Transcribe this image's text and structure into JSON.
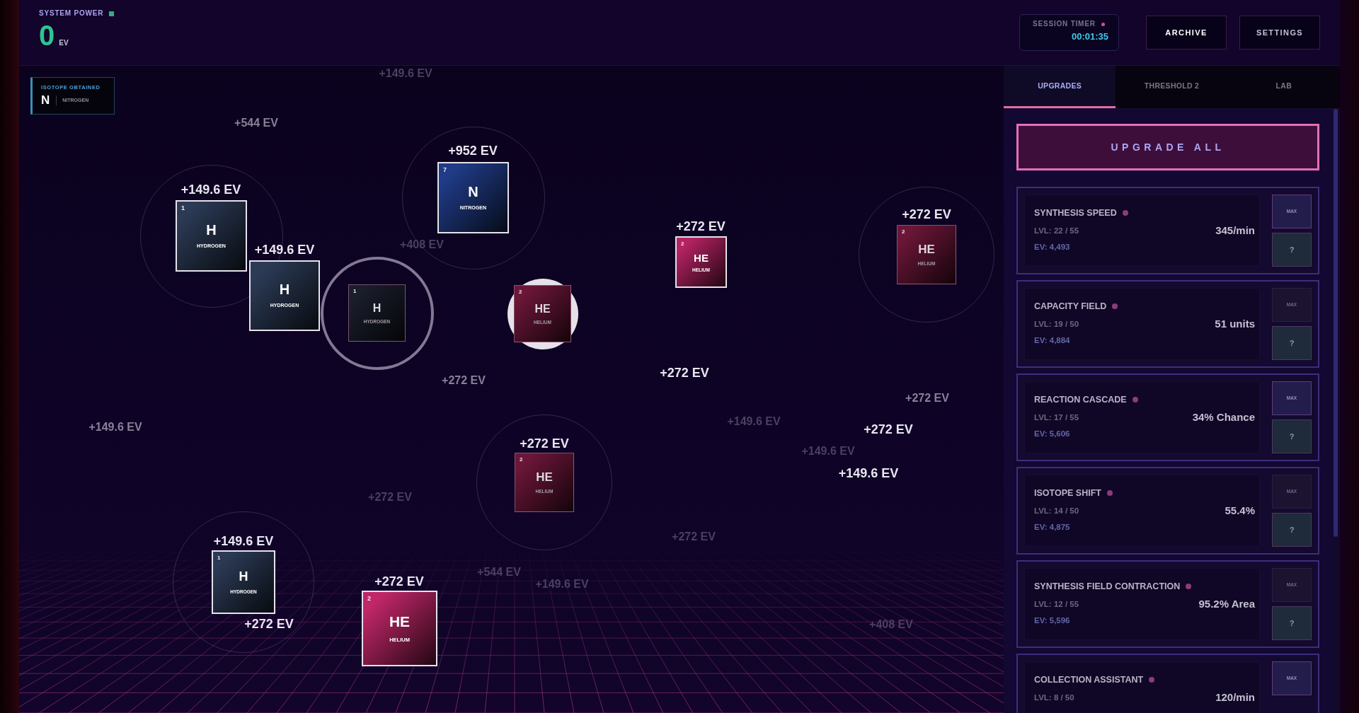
{
  "header": {
    "power": {
      "label": "SYSTEM POWER",
      "value": "0",
      "unit": "EV"
    },
    "timer": {
      "label": "SESSION TIMER",
      "value": "00:01:35"
    },
    "buttons": [
      {
        "label": "ARCHIVE",
        "highlighted": true
      },
      {
        "label": "SETTINGS",
        "highlighted": false
      }
    ]
  },
  "field": {
    "toast": {
      "title": "ISOTOPE OBTAINED",
      "symbol": "N",
      "name": "NITROGEN"
    },
    "tiles": [
      {
        "kind": "ringed",
        "number": "7",
        "symbol": "N",
        "name": "NITROGEN",
        "color": "#203c88",
        "highlighted": true
      },
      {
        "kind": "ringed",
        "number": "1",
        "symbol": "H",
        "name": "HYDROGEN",
        "color": "#2b3a55",
        "highlighted": true
      },
      {
        "kind": "ringed",
        "number": "2",
        "symbol": "HE",
        "name": "HELIUM",
        "color": "#6c1638",
        "highlighted": false
      },
      {
        "kind": "plain",
        "number": "2",
        "symbol": "HE",
        "name": "HELIUM",
        "color": "#b52262",
        "highlighted": true
      },
      {
        "kind": "plain",
        "symbol": "H",
        "name": "HYDROGEN",
        "color": "#2b3a55",
        "highlighted": true
      },
      {
        "kind": "selected",
        "number": "1",
        "symbol": "H",
        "name": "HYDROGEN",
        "color": "#1a1e2c",
        "highlighted": false
      },
      {
        "kind": "glowing",
        "number": "2",
        "symbol": "HE",
        "name": "HELIUM",
        "color": "#6c1638",
        "highlighted": false
      },
      {
        "kind": "ringed",
        "number": "2",
        "symbol": "HE",
        "name": "HELIUM",
        "color": "#6c1638",
        "highlighted": false
      },
      {
        "kind": "ringed",
        "number": "1",
        "symbol": "H",
        "name": "HYDROGEN",
        "color": "#2b3a55",
        "highlighted": true
      },
      {
        "kind": "plain",
        "number": "2",
        "symbol": "HE",
        "name": "HELIUM",
        "color": "#c02668",
        "highlighted": true
      }
    ],
    "gains": [
      {
        "text": "+149.6 EV",
        "kind": "faint"
      },
      {
        "text": "+544 EV",
        "kind": "mid"
      },
      {
        "text": "+952 EV",
        "kind": "bright"
      },
      {
        "text": "+149.6 EV",
        "kind": "bright"
      },
      {
        "text": "+272 EV",
        "kind": "bright"
      },
      {
        "text": "+272 EV",
        "kind": "bright"
      },
      {
        "text": "+408 EV",
        "kind": "faint"
      },
      {
        "text": "+149.6 EV",
        "kind": "bright"
      },
      {
        "text": "+272 EV",
        "kind": "bright"
      },
      {
        "text": "+272 EV",
        "kind": "mid"
      },
      {
        "text": "+272 EV",
        "kind": "mid"
      },
      {
        "text": "+149.6 EV",
        "kind": "faint"
      },
      {
        "text": "+149.6 EV",
        "kind": "mid"
      },
      {
        "text": "+272 EV",
        "kind": "bright"
      },
      {
        "text": "+272 EV",
        "kind": "bright"
      },
      {
        "text": "+149.6 EV",
        "kind": "faint"
      },
      {
        "text": "+149.6 EV",
        "kind": "bright"
      },
      {
        "text": "+272 EV",
        "kind": "faint"
      },
      {
        "text": "+272 EV",
        "kind": "faint"
      },
      {
        "text": "+149.6 EV",
        "kind": "bright"
      },
      {
        "text": "+544 EV",
        "kind": "faint"
      },
      {
        "text": "+272 EV",
        "kind": "bright"
      },
      {
        "text": "+149.6 EV",
        "kind": "faint"
      },
      {
        "text": "+272 EV",
        "kind": "bright"
      },
      {
        "text": "+408 EV",
        "kind": "faint"
      }
    ]
  },
  "panel": {
    "tabs": [
      {
        "label": "UPGRADES",
        "selected": true
      },
      {
        "label": "THRESHOLD 2",
        "selected": false
      },
      {
        "label": "LAB",
        "selected": false
      }
    ],
    "upgrade_all": "UPGRADE ALL",
    "upgrades": [
      {
        "name": "SYNTHESIS SPEED",
        "lvl": "LVL: 22 / 55",
        "cost": "EV: 4,493",
        "value": "345/min",
        "max_label": "MAX",
        "max_enabled": true,
        "help": "?"
      },
      {
        "name": "CAPACITY FIELD",
        "lvl": "LVL: 19 / 50",
        "cost": "EV: 4,884",
        "value": "51 units",
        "max_label": "MAX",
        "max_enabled": false,
        "help": "?"
      },
      {
        "name": "REACTION CASCADE",
        "lvl": "LVL: 17 / 55",
        "cost": "EV: 5,606",
        "value": "34% Chance",
        "max_label": "MAX",
        "max_enabled": true,
        "help": "?"
      },
      {
        "name": "ISOTOPE SHIFT",
        "lvl": "LVL: 14 / 50",
        "cost": "EV: 4,875",
        "value": "55.4%",
        "max_label": "MAX",
        "max_enabled": false,
        "help": "?"
      },
      {
        "name": "SYNTHESIS FIELD CONTRACTION",
        "lvl": "LVL: 12 / 55",
        "cost": "EV: 5,596",
        "value": "95.2% Area",
        "max_label": "MAX",
        "max_enabled": false,
        "help": "?"
      },
      {
        "name": "COLLECTION ASSISTANT",
        "lvl": "LVL: 8 / 50",
        "value": "120/min",
        "max_label": "MAX",
        "max_enabled": true
      }
    ]
  }
}
